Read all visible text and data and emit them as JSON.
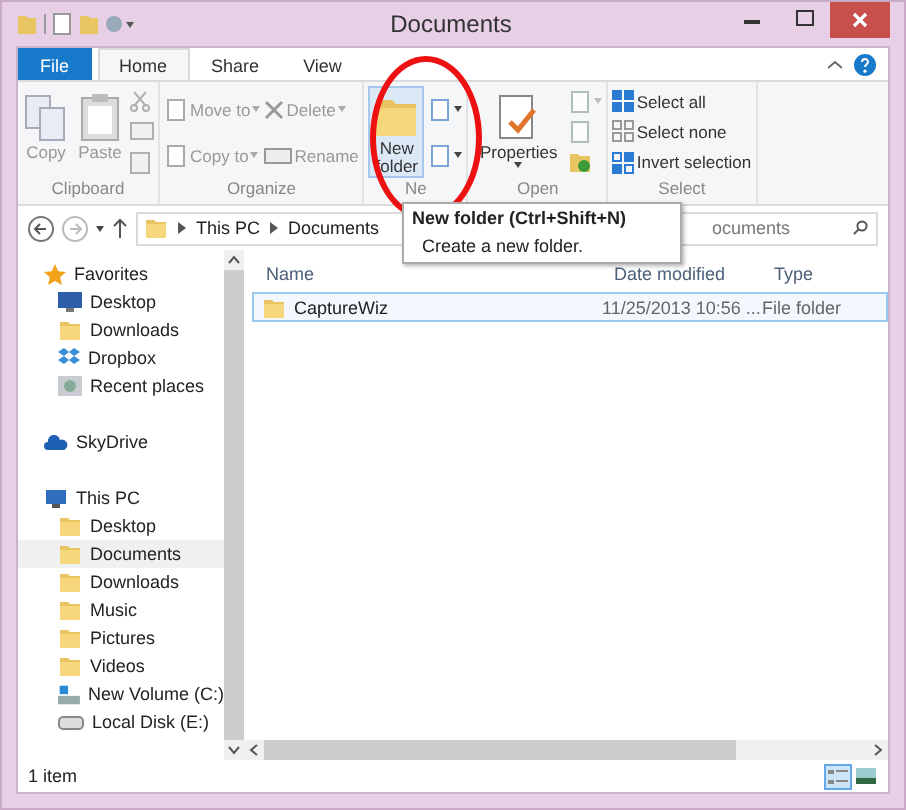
{
  "window": {
    "title": "Documents"
  },
  "tabs": [
    {
      "label": "File",
      "kind": "file",
      "selected": false
    },
    {
      "label": "Home",
      "kind": "tab",
      "selected": true
    },
    {
      "label": "Share",
      "kind": "tab",
      "selected": false
    },
    {
      "label": "View",
      "kind": "tab",
      "selected": false
    }
  ],
  "ribbon": [
    {
      "label": "Clipboard",
      "columns": [
        [
          {
            "kind": "large",
            "label": "Copy",
            "disabled": true,
            "dropdown": false
          }
        ],
        [
          {
            "kind": "large",
            "label": "Paste",
            "disabled": true,
            "dropdown": false
          }
        ],
        [
          {
            "kind": "icon",
            "disabled": true,
            "dropdown": false
          },
          {
            "kind": "icon",
            "disabled": true,
            "dropdown": false
          },
          {
            "kind": "icon",
            "disabled": true,
            "dropdown": false
          }
        ]
      ]
    },
    {
      "label": "Organize",
      "columns": [
        [
          {
            "kind": "small",
            "label": "Move to",
            "disabled": true,
            "dropdown": true
          },
          {
            "kind": "small",
            "label": "Copy to",
            "disabled": true,
            "dropdown": true
          }
        ],
        [
          {
            "kind": "small",
            "label": "Delete",
            "disabled": true,
            "dropdown": true
          },
          {
            "kind": "small",
            "label": "Rename",
            "disabled": true,
            "dropdown": false
          }
        ]
      ]
    },
    {
      "label": "Ne",
      "columns": [
        [
          {
            "kind": "large",
            "label": "New folder",
            "disabled": false,
            "dropdown": false
          }
        ],
        [
          {
            "kind": "icon",
            "disabled": false,
            "dropdown": true
          },
          {
            "kind": "icon",
            "disabled": false,
            "dropdown": true
          }
        ]
      ]
    },
    {
      "label": "Open",
      "columns": [
        [
          {
            "kind": "large",
            "label": "Properties",
            "disabled": false,
            "dropdown": true
          }
        ],
        [
          {
            "kind": "icon",
            "disabled": true,
            "dropdown": true
          },
          {
            "kind": "icon",
            "disabled": true,
            "dropdown": false
          },
          {
            "kind": "icon",
            "disabled": false,
            "dropdown": false
          }
        ]
      ]
    },
    {
      "label": "Select",
      "columns": [
        [
          {
            "kind": "small",
            "label": "Select all",
            "disabled": false,
            "dropdown": false
          },
          {
            "kind": "small",
            "label": "Select none",
            "disabled": false,
            "dropdown": false
          },
          {
            "kind": "small",
            "label": "Invert selection",
            "disabled": false,
            "dropdown": false
          }
        ]
      ]
    }
  ],
  "address": {
    "path": [
      "This PC",
      "Documents"
    ],
    "search": "ocuments"
  },
  "tooltip": {
    "title": "New folder (Ctrl+Shift+N)",
    "text": "Create a new folder."
  },
  "navigation": [
    {
      "label": "Favorites",
      "selected": false,
      "children": [
        {
          "label": "Desktop",
          "selected": false
        },
        {
          "label": "Downloads",
          "selected": false
        },
        {
          "label": "Dropbox",
          "selected": false
        },
        {
          "label": "Recent places",
          "selected": false
        }
      ]
    },
    {
      "label": "SkyDrive",
      "selected": false
    },
    {
      "label": "This PC",
      "selected": false,
      "children": [
        {
          "label": "Desktop",
          "selected": false
        },
        {
          "label": "Documents",
          "selected": true
        },
        {
          "label": "Downloads",
          "selected": false
        },
        {
          "label": "Music",
          "selected": false
        },
        {
          "label": "Pictures",
          "selected": false
        },
        {
          "label": "Videos",
          "selected": false
        },
        {
          "label": "New Volume (C:)",
          "selected": false
        },
        {
          "label": "Local Disk (E:)",
          "selected": false
        }
      ]
    }
  ],
  "table": {
    "columns": [
      "Name",
      "Date modified",
      "Type"
    ],
    "rows": [
      {
        "cells": [
          "CaptureWiz",
          "11/25/2013 10:56 ...",
          "File folder"
        ],
        "selected": true
      }
    ]
  },
  "status_bar": {
    "text": "1 item",
    "views": [
      {
        "selected": true
      },
      {
        "selected": false
      }
    ]
  }
}
